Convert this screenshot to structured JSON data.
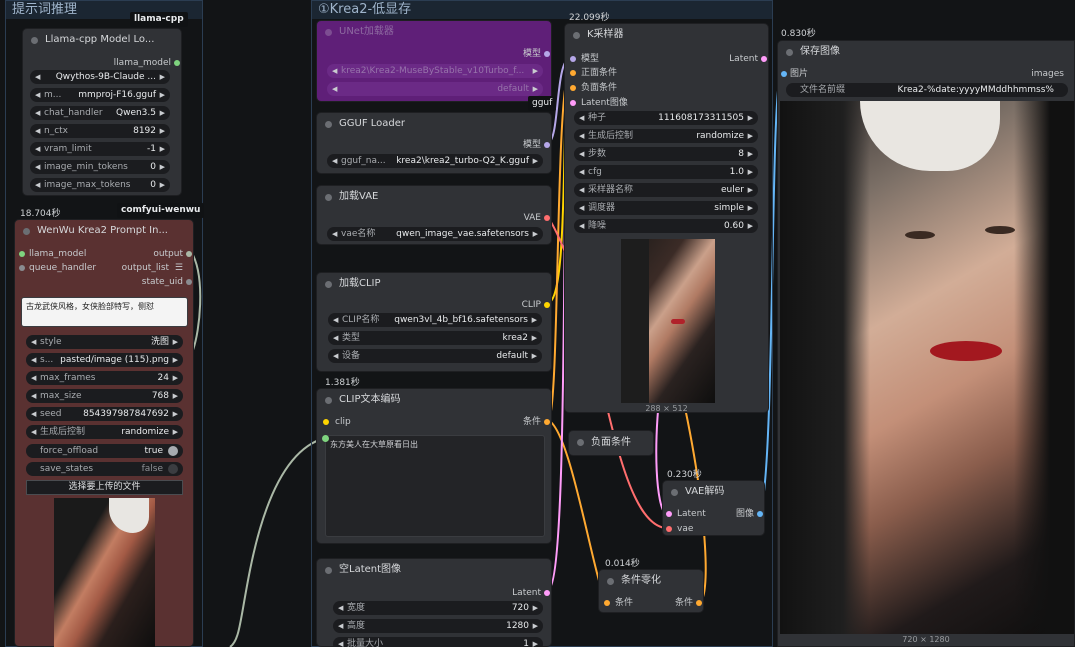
{
  "groups": {
    "left_title": "提示词推理",
    "main_title": "①Krea2-低显存"
  },
  "badges": {
    "llama_cpp": "llama-cpp",
    "comfyui_wenwu": "comfyui-wenwu"
  },
  "llama_loader": {
    "title": "Llama-cpp Model Lo...",
    "output": "llama_model",
    "widgets": [
      {
        "label": "",
        "value": "Qwythos-9B-Claude ..."
      },
      {
        "label": "m...",
        "value": "mmproj-F16.gguf"
      },
      {
        "label": "chat_handler",
        "value": "Qwen3.5"
      },
      {
        "label": "n_ctx",
        "value": "8192"
      },
      {
        "label": "vram_limit",
        "value": "-1"
      },
      {
        "label": "image_min_tokens",
        "value": "0"
      },
      {
        "label": "image_max_tokens",
        "value": "0"
      }
    ]
  },
  "wenwu": {
    "time": "18.704秒",
    "title": "WenWu Krea2 Prompt In...",
    "in1": "llama_model",
    "in2": "queue_handler",
    "out1": "output",
    "out2": "output_list",
    "out3": "state_uid",
    "prompt_text": "古龙武侠风格，女侠脸部特写，侧怼",
    "widgets": [
      {
        "label": "style",
        "value": "洗图"
      },
      {
        "label": "s...",
        "value": "pasted/image (115).png"
      },
      {
        "label": "max_frames",
        "value": "24"
      },
      {
        "label": "max_size",
        "value": "768"
      },
      {
        "label": "seed",
        "value": "854397987847692"
      },
      {
        "label": "生成后控制",
        "value": "randomize"
      }
    ],
    "force_offload_label": "force_offload",
    "force_offload_value": "true",
    "save_states_label": "save_states",
    "save_states_value": "false",
    "upload_label": "选择要上传的文件"
  },
  "unet_loader": {
    "title": "UNet加载器",
    "output": "模型",
    "value1": "krea2\\Krea2-MuseByStable_v10Turbo_f...",
    "value2": "default",
    "footer": "gguf"
  },
  "gguf_loader": {
    "title": "GGUF Loader",
    "output": "模型",
    "widget_label": "gguf_na...",
    "widget_value": "krea2\\krea2_turbo-Q2_K.gguf"
  },
  "vae_loader": {
    "title": "加载VAE",
    "output": "VAE",
    "widget_label": "vae名称",
    "widget_value": "qwen_image_vae.safetensors"
  },
  "clip_loader": {
    "title": "加载CLIP",
    "output": "CLIP",
    "widgets": [
      {
        "label": "CLIP名称",
        "value": "qwen3vl_4b_bf16.safetensors"
      },
      {
        "label": "类型",
        "value": "krea2"
      },
      {
        "label": "设备",
        "value": "default"
      }
    ]
  },
  "clip_encode": {
    "time": "1.381秒",
    "title": "CLIP文本编码",
    "input": "clip",
    "output": "条件",
    "text": "东方美人在大草原看日出"
  },
  "empty_latent": {
    "title": "空Latent图像",
    "output": "Latent",
    "widgets": [
      {
        "label": "宽度",
        "value": "720"
      },
      {
        "label": "高度",
        "value": "1280"
      },
      {
        "label": "批量大小",
        "value": "1"
      }
    ]
  },
  "ksampler": {
    "time": "22.099秒",
    "title": "K采样器",
    "inputs": [
      "模型",
      "正面条件",
      "负面条件",
      "Latent图像"
    ],
    "output": "Latent",
    "widgets": [
      {
        "label": "种子",
        "value": "111608173311505"
      },
      {
        "label": "生成后控制",
        "value": "randomize"
      },
      {
        "label": "步数",
        "value": "8"
      },
      {
        "label": "cfg",
        "value": "1.0"
      },
      {
        "label": "采样器名称",
        "value": "euler"
      },
      {
        "label": "调度器",
        "value": "simple"
      },
      {
        "label": "降噪",
        "value": "0.60"
      }
    ],
    "preview_size": "288 × 512"
  },
  "neg_cond": {
    "title": "负面条件"
  },
  "vae_decode": {
    "time": "0.230秒",
    "title": "VAE解码",
    "in1": "Latent",
    "in2": "vae",
    "output": "图像"
  },
  "cond_zero": {
    "time": "0.014秒",
    "title": "条件零化",
    "input": "条件",
    "output": "条件"
  },
  "save_image": {
    "time": "0.830秒",
    "title": "保存图像",
    "input": "图片",
    "output": "images",
    "prefix_label": "文件名前缀",
    "prefix_value": "Krea2-%date:yyyyMMddhhmmss%",
    "image_size": "720 × 1280"
  },
  "colors": {
    "model": "#b5a7e8",
    "conditioning": "#ffa931",
    "latent": "#ff9cf9",
    "vae": "#ff6e6e",
    "clip": "#ffd500",
    "image": "#64b5f6",
    "llama": "#7fd47f"
  }
}
